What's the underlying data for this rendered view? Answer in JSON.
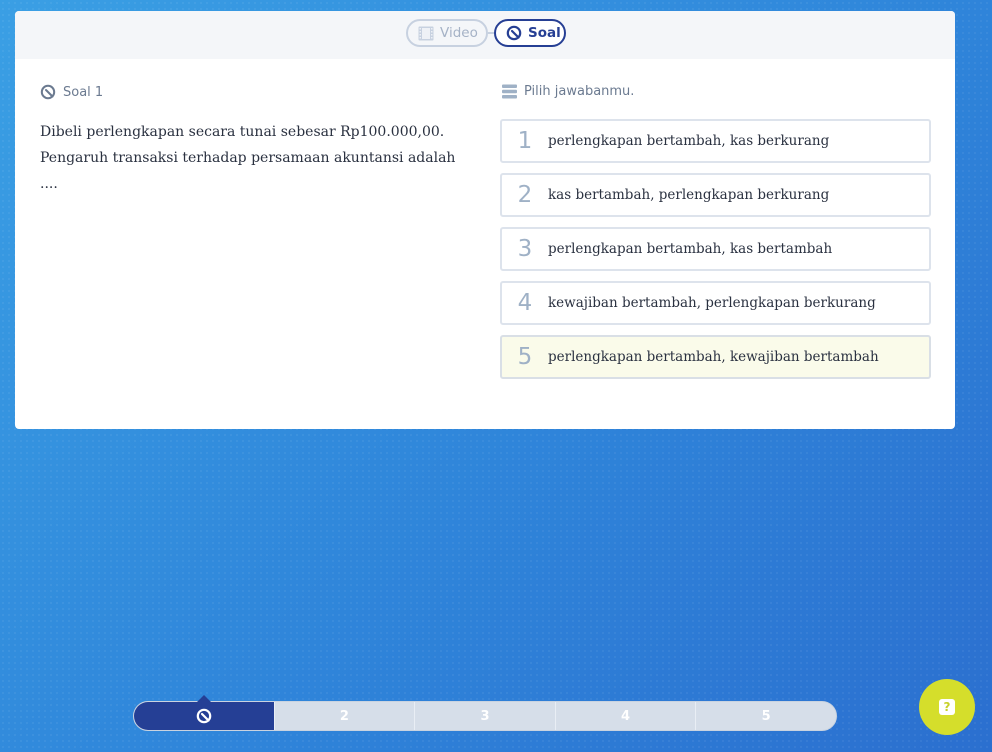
{
  "tabs": {
    "video_label": "Video",
    "soal_label": "Soal"
  },
  "question": {
    "heading": "Soal 1",
    "text": "Dibeli perlengkapan secara tunai sebesar Rp100.000,00. Pengaruh transaksi terhadap persamaan akuntansi adalah ...."
  },
  "answers": {
    "heading": "Pilih jawabanmu.",
    "options": [
      {
        "num": "1",
        "text": "perlengkapan bertambah, kas berkurang"
      },
      {
        "num": "2",
        "text": "kas bertambah, perlengkapan berkurang"
      },
      {
        "num": "3",
        "text": "perlengkapan bertambah, kas bertambah"
      },
      {
        "num": "4",
        "text": "kewajiban bertambah, perlengkapan berkurang"
      },
      {
        "num": "5",
        "text": "perlengkapan bertambah, kewajiban bertambah"
      }
    ]
  },
  "nav": {
    "items": [
      "",
      "2",
      "3",
      "4",
      "5"
    ],
    "active_icon": "quiz-icon"
  },
  "help": {
    "label": "?",
    "icon": "help-icon"
  },
  "colors": {
    "brand_navy": "#253f95",
    "help_yellow": "#d5de2b",
    "highlight_option": "#fafbea",
    "background_blue": "#3a8fdc"
  }
}
